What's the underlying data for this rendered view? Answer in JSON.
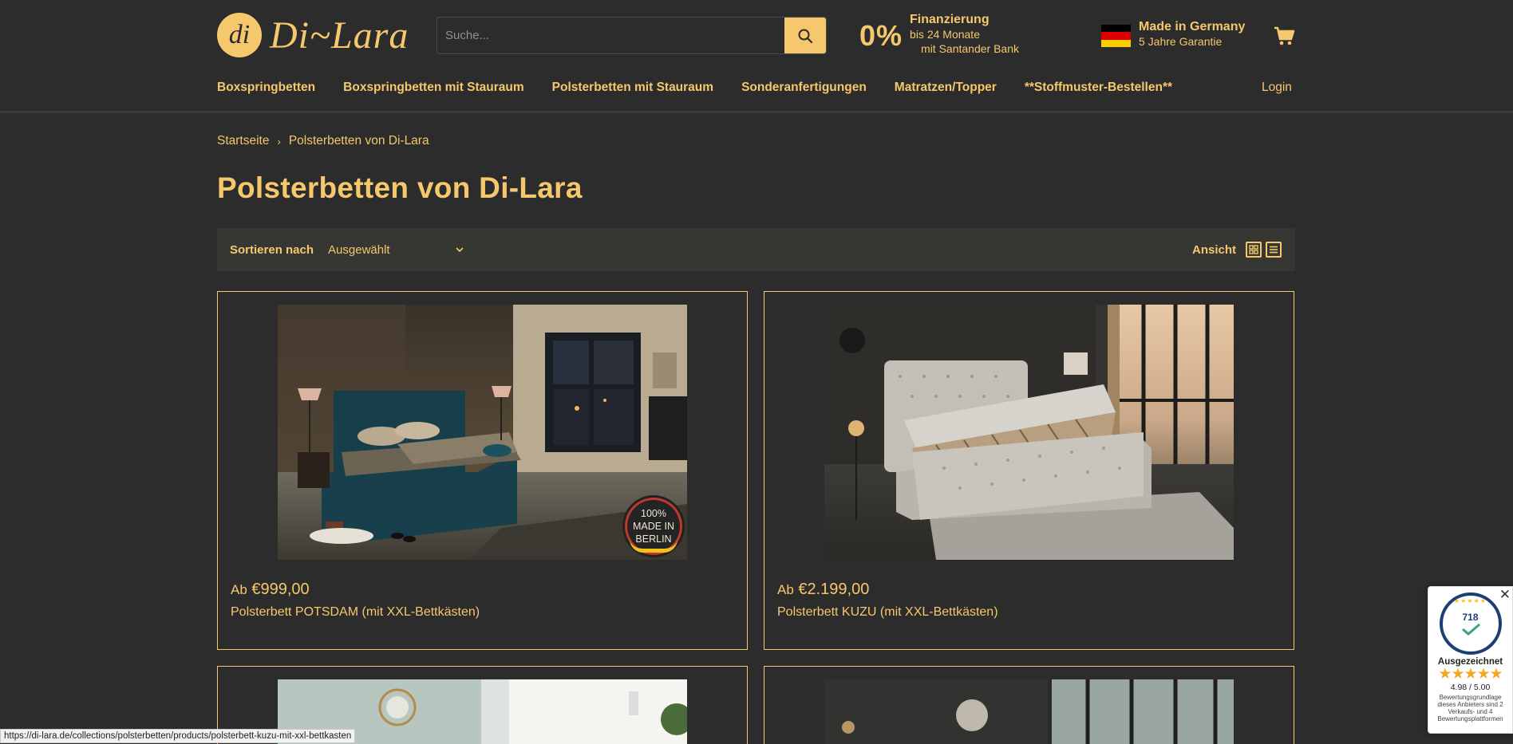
{
  "brand": {
    "logo_mark": "di",
    "name": "Di~Lara"
  },
  "search": {
    "placeholder": "Suche..."
  },
  "finance": {
    "percent": "0%",
    "title": "Finanzierung",
    "line1": "bis 24 Monate",
    "line2": "mit Santander Bank"
  },
  "germany": {
    "title": "Made in Germany",
    "subtitle": "5 Jahre Garantie"
  },
  "nav": {
    "items": [
      "Boxspringbetten",
      "Boxspringbetten mit Stauraum",
      "Polsterbetten mit Stauraum",
      "Sonderanfertigungen",
      "Matratzen/Topper",
      "**Stoffmuster-Bestellen**"
    ],
    "login": "Login"
  },
  "breadcrumb": {
    "home": "Startseite",
    "sep": "›",
    "current": "Polsterbetten von Di-Lara"
  },
  "page_title": "Polsterbetten von Di-Lara",
  "toolbar": {
    "sort_label": "Sortieren nach",
    "sort_value": "Ausgewählt",
    "view_label": "Ansicht"
  },
  "products": [
    {
      "price_prefix": "Ab",
      "price": "€999,00",
      "name": "Polsterbett POTSDAM (mit XXL-Bettkästen)",
      "badge": [
        "100%",
        "MADE IN",
        "BERLIN"
      ]
    },
    {
      "price_prefix": "Ab",
      "price": "€2.199,00",
      "name": "Polsterbett KUZU (mit XXL-Bettkästen)"
    }
  ],
  "status_url": "https://di-lara.de/collections/polsterbetten/products/polsterbett-kuzu-mit-xxl-bettkasten",
  "trust_widget": {
    "count": "718",
    "title": "Ausgezeichnet",
    "stars": "★★★★★",
    "score": "4.98 / 5.00",
    "desc": "Bewertungsgrundlage dieses Anbieters sind 2 Verkaufs- und 4 Bewertungsplattformen",
    "close": "✕"
  },
  "colors": {
    "background": "#2b2c2b",
    "accent": "#f6c86d",
    "toolbar": "#363632"
  },
  "flag_colors": [
    "#000000",
    "#dd0000",
    "#ffce00"
  ]
}
